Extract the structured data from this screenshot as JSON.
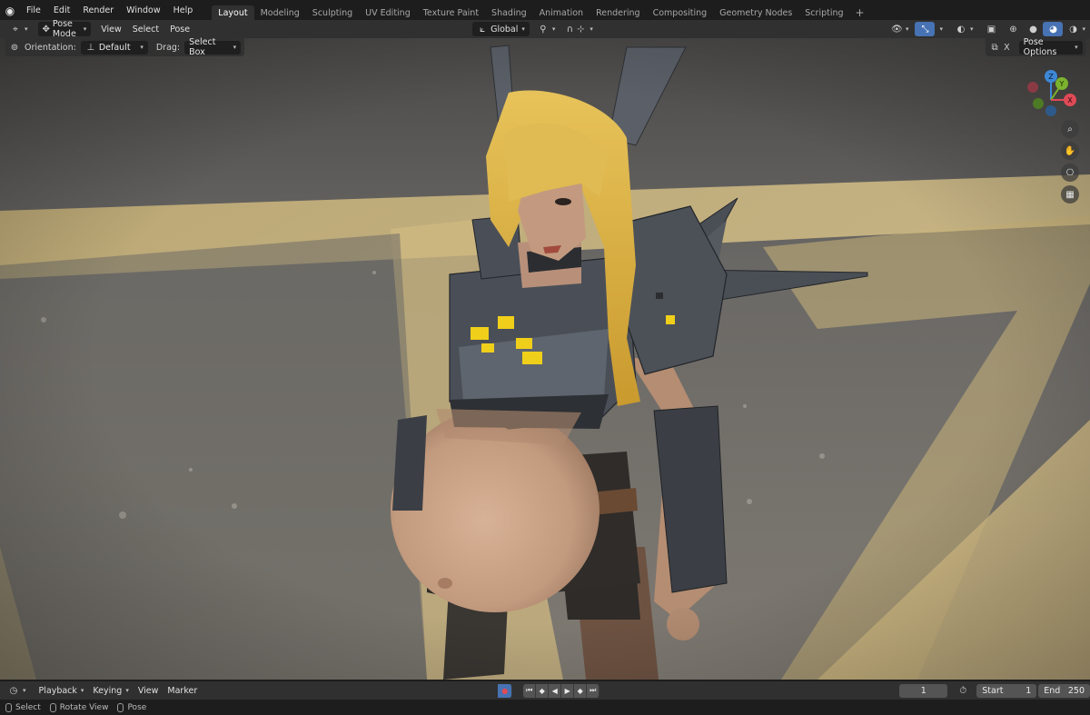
{
  "menubar": {
    "logo_icon": "blender-logo-icon",
    "items": [
      "File",
      "Edit",
      "Render",
      "Window",
      "Help"
    ]
  },
  "workspaces": {
    "active": "Layout",
    "tabs": [
      "Layout",
      "Modeling",
      "Sculpting",
      "UV Editing",
      "Texture Paint",
      "Shading",
      "Animation",
      "Rendering",
      "Compositing",
      "Geometry Nodes",
      "Scripting"
    ],
    "add_label": "+"
  },
  "viewport_header": {
    "mode": "Pose Mode",
    "menus": [
      "View",
      "Select",
      "Pose"
    ],
    "transform_orientation": "Global",
    "accent_color": "#4772b3"
  },
  "tool_settings": {
    "orientation_label": "Orientation:",
    "orientation_value": "Default",
    "drag_label": "Drag:",
    "drag_value": "Select Box",
    "axis_x_label": "X",
    "pose_options": "Pose Options"
  },
  "gizmo": {
    "axis_z": "Z",
    "axis_y": "Y",
    "axis_x": "X",
    "color_x": "#e04a57",
    "color_y": "#7bb32e",
    "color_z": "#3d88d6"
  },
  "timeline": {
    "menus": [
      "Playback",
      "Keying",
      "View",
      "Marker"
    ],
    "current_frame": "1",
    "start_label": "Start",
    "start_value": "1",
    "end_label": "End",
    "end_value": "250"
  },
  "statusbar": {
    "items": [
      "Select",
      "Rotate View",
      "Pose"
    ]
  }
}
